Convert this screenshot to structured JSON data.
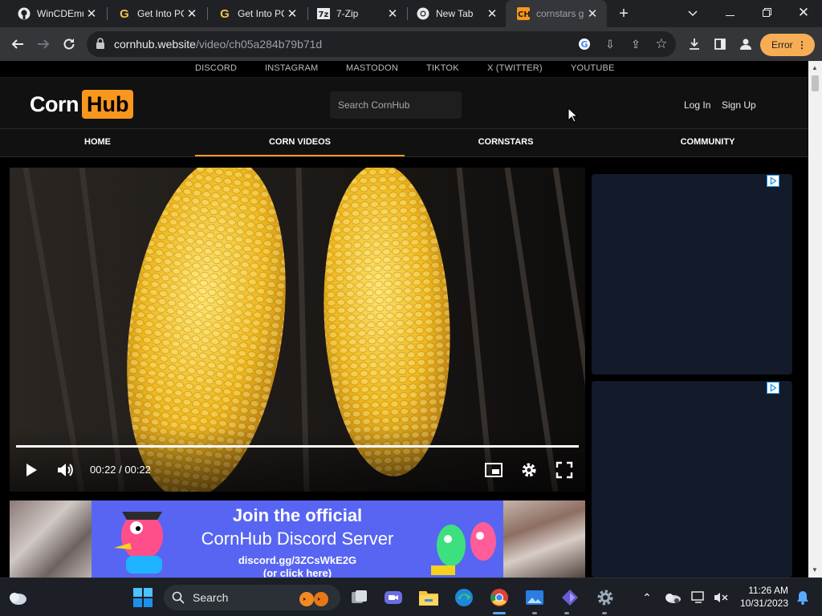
{
  "browser": {
    "tabs": [
      {
        "title": "WinCDEmu",
        "icon": "github-icon"
      },
      {
        "title": "Get Into PC",
        "icon": "getintopc-icon"
      },
      {
        "title": "Get Into PC",
        "icon": "getintopc-icon"
      },
      {
        "title": "7-Zip",
        "icon": "7zip-icon"
      },
      {
        "title": "New Tab",
        "icon": "chrome-icon"
      },
      {
        "title": "cornstars g",
        "icon": "cornhub-icon",
        "active": true
      }
    ],
    "url_host": "cornhub.website",
    "url_path": "/video/ch05a284b79b71d",
    "error_label": "Error",
    "accent_error": "#f6ae55"
  },
  "site": {
    "social_links": [
      "DISCORD",
      "INSTAGRAM",
      "MASTODON",
      "TIKTOK",
      "X (TWITTER)",
      "YOUTUBE"
    ],
    "logo_left": "Corn",
    "logo_right": "Hub",
    "search_placeholder": "Search CornHub",
    "login": "Log In",
    "signup": "Sign Up",
    "nav": [
      "HOME",
      "CORN VIDEOS",
      "CORNSTARS",
      "COMMUNITY"
    ],
    "active_nav": "CORN VIDEOS",
    "brand_color": "#f7971d"
  },
  "player": {
    "time": "00:22 / 00:22",
    "progress": 1.0
  },
  "banner": {
    "line1": "Join the official",
    "line2": "CornHub Discord Server",
    "line3": "discord.gg/3ZCsWkE2G",
    "line4": "(or click here)"
  },
  "taskbar": {
    "search_label": "Search",
    "time": "11:26 AM",
    "date": "10/31/2023"
  }
}
